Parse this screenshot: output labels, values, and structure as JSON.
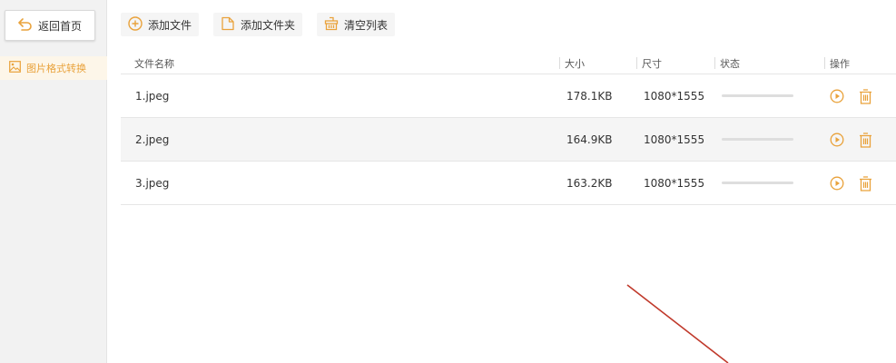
{
  "sidebar": {
    "back_label": "返回首页",
    "items": [
      {
        "label": "图片格式转换",
        "icon": "image-icon",
        "active": true
      }
    ]
  },
  "toolbar": {
    "add_file_label": "添加文件",
    "add_folder_label": "添加文件夹",
    "clear_list_label": "清空列表"
  },
  "table": {
    "headers": {
      "name": "文件名称",
      "size": "大小",
      "dimensions": "尺寸",
      "status": "状态",
      "actions": "操作"
    },
    "rows": [
      {
        "name": "1.jpeg",
        "size": "178.1KB",
        "dimensions": "1080*1555",
        "progress": 0
      },
      {
        "name": "2.jpeg",
        "size": "164.9KB",
        "dimensions": "1080*1555",
        "progress": 0
      },
      {
        "name": "3.jpeg",
        "size": "163.2KB",
        "dimensions": "1080*1555",
        "progress": 0
      }
    ]
  },
  "colors": {
    "accent": "#e9a23b",
    "annotation_arrow": "#c0392b"
  }
}
